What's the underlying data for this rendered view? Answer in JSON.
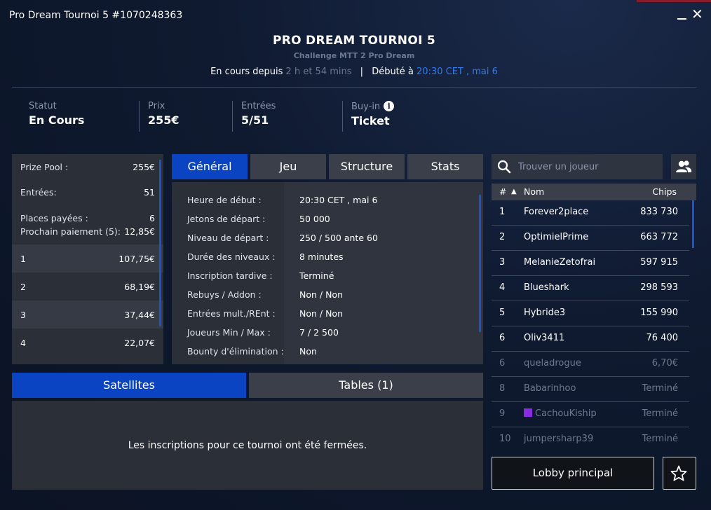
{
  "window": {
    "title": "Pro Dream Tournoi 5 #1070248363"
  },
  "header": {
    "title": "PRO DREAM TOURNOI 5",
    "subtitle": "Challenge MTT 2 Pro Dream",
    "running_label": "En cours depuis",
    "running_value": "2 h et 54 mins",
    "separator": "|",
    "started_label": "Débuté à",
    "started_value": "20:30 CET , mai 6"
  },
  "stats": [
    {
      "label": "Statut",
      "value": "En Cours"
    },
    {
      "label": "Prix",
      "value": "255€"
    },
    {
      "label": "Entrées",
      "value": "5/51"
    },
    {
      "label": "Buy-in",
      "value": "Ticket"
    }
  ],
  "prize": {
    "pool_label": "Prize Pool :",
    "pool_value": "255€",
    "entries_label": "Entrées:",
    "entries_value": "51",
    "paid_label": "Places payées :",
    "paid_value": "6",
    "next_label": "Prochain paiement (5):",
    "next_value": "12,85€",
    "places": [
      {
        "place": "1",
        "amount": "107,75€"
      },
      {
        "place": "2",
        "amount": "68,19€"
      },
      {
        "place": "3",
        "amount": "37,44€"
      },
      {
        "place": "4",
        "amount": "22,07€"
      }
    ]
  },
  "tabs": [
    "Général",
    "Jeu",
    "Structure",
    "Stats"
  ],
  "general": [
    {
      "k": "Heure de début :",
      "v": "20:30 CET , mai 6"
    },
    {
      "k": "Jetons de départ :",
      "v": "50 000"
    },
    {
      "k": "Niveau de départ :",
      "v": "250 / 500 ante 60"
    },
    {
      "k": "Durée des niveaux :",
      "v": "8 minutes"
    },
    {
      "k": "Inscription tardive :",
      "v": "Terminé"
    },
    {
      "k": "Rebuys / Addon :",
      "v": "Non / Non"
    },
    {
      "k": "Entrées mult./REnt :",
      "v": "Non / Non"
    },
    {
      "k": "Joueurs Min / Max :",
      "v": "7 / 2 500"
    },
    {
      "k": "Bounty d'élimination :",
      "v": "Non"
    }
  ],
  "bottom_tabs": [
    "Satellites",
    "Tables (1)"
  ],
  "satellites_message": "Les inscriptions pour ce tournoi ont été fermées.",
  "search": {
    "placeholder": "Trouver un joueur"
  },
  "player_header": {
    "num": "#",
    "sort": "▲",
    "name": "Nom",
    "chips": "Chips"
  },
  "players": [
    {
      "num": "1",
      "name": "Forever2place",
      "chips": "833 730"
    },
    {
      "num": "2",
      "name": "OptimielPrime",
      "chips": "663 772"
    },
    {
      "num": "3",
      "name": "MelanieZetofrai",
      "chips": "597 915"
    },
    {
      "num": "4",
      "name": "Blueshark",
      "chips": "298 593"
    },
    {
      "num": "5",
      "name": "Hybride3",
      "chips": "155 990"
    },
    {
      "num": "6",
      "name": "Oliv3411",
      "chips": "76 400"
    },
    {
      "num": "6",
      "name": "queladrogue",
      "chips": "6,70€"
    },
    {
      "num": "8",
      "name": "Babarinhoo",
      "chips": "Terminé"
    },
    {
      "num": "9",
      "name": "CachouKiship",
      "chips": "Terminé"
    },
    {
      "num": "10",
      "name": "jumpersharp39",
      "chips": "Terminé"
    }
  ],
  "buttons": {
    "lobby": "Lobby principal"
  },
  "icons": {
    "minimize": "minimize-icon",
    "close": "close-icon",
    "info": "info-icon",
    "search": "search-icon",
    "friends": "users-icon",
    "favorite": "star-icon",
    "flag": "flag-icon"
  },
  "colors": {
    "accent": "#0b44c2",
    "link": "#2f7bf0",
    "flag": "#8a2be2"
  }
}
